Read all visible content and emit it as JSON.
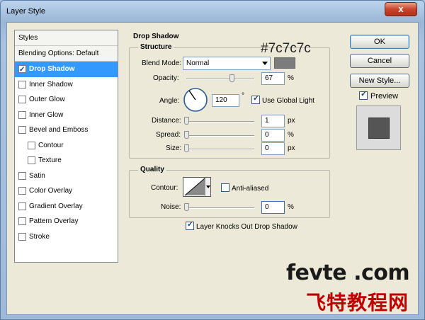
{
  "window": {
    "title": "Layer Style",
    "close_glyph": "x"
  },
  "styles_panel": {
    "header": "Styles",
    "blending": "Blending Options: Default",
    "items": [
      {
        "label": "Drop Shadow",
        "checked": true,
        "selected": true,
        "sub": false
      },
      {
        "label": "Inner Shadow",
        "checked": false,
        "selected": false,
        "sub": false
      },
      {
        "label": "Outer Glow",
        "checked": false,
        "selected": false,
        "sub": false
      },
      {
        "label": "Inner Glow",
        "checked": false,
        "selected": false,
        "sub": false
      },
      {
        "label": "Bevel and Emboss",
        "checked": false,
        "selected": false,
        "sub": false
      },
      {
        "label": "Contour",
        "checked": false,
        "selected": false,
        "sub": true
      },
      {
        "label": "Texture",
        "checked": false,
        "selected": false,
        "sub": true
      },
      {
        "label": "Satin",
        "checked": false,
        "selected": false,
        "sub": false
      },
      {
        "label": "Color Overlay",
        "checked": false,
        "selected": false,
        "sub": false
      },
      {
        "label": "Gradient Overlay",
        "checked": false,
        "selected": false,
        "sub": false
      },
      {
        "label": "Pattern Overlay",
        "checked": false,
        "selected": false,
        "sub": false
      },
      {
        "label": "Stroke",
        "checked": false,
        "selected": false,
        "sub": false
      }
    ]
  },
  "drop_shadow": {
    "section_title": "Drop Shadow",
    "structure": {
      "title": "Structure",
      "blend_mode_label": "Blend Mode:",
      "blend_mode_value": "Normal",
      "color_note": "#7c7c7c",
      "swatch_color": "#7c7c7c",
      "opacity_label": "Opacity:",
      "opacity_value": "67",
      "opacity_level": 67,
      "opacity_unit": "%",
      "angle_label": "Angle:",
      "angle_value": "120",
      "angle_unit": "°",
      "global_light_label": "Use Global Light",
      "global_light_checked": true,
      "distance_label": "Distance:",
      "distance_value": "1",
      "distance_unit": "px",
      "spread_label": "Spread:",
      "spread_value": "0",
      "spread_unit": "%",
      "size_label": "Size:",
      "size_value": "0",
      "size_unit": "px"
    },
    "quality": {
      "title": "Quality",
      "contour_label": "Contour:",
      "anti_aliased_label": "Anti-aliased",
      "anti_aliased_checked": false,
      "noise_label": "Noise:",
      "noise_value": "0",
      "noise_unit": "%"
    },
    "knockout_label": "Layer Knocks Out Drop Shadow",
    "knockout_checked": true
  },
  "buttons": {
    "ok": "OK",
    "cancel": "Cancel",
    "new_style": "New Style...",
    "preview_label": "Preview",
    "preview_checked": true
  },
  "watermark": {
    "latin": "fevte .com",
    "cjk": "飞特教程网"
  },
  "colors": {
    "selection": "#3399ff",
    "dialog_bg": "#ece9d8",
    "preview_square": "#555555"
  }
}
